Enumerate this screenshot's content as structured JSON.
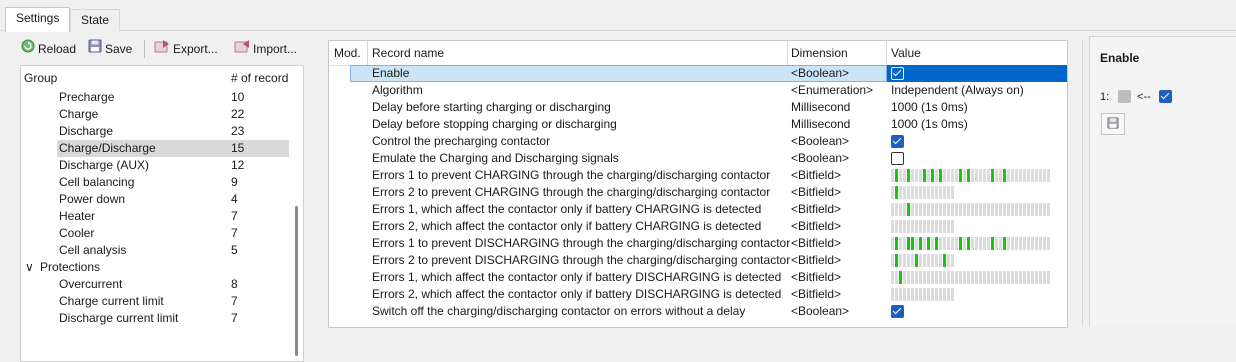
{
  "tabs": [
    {
      "label": "Settings",
      "active": true
    },
    {
      "label": "State",
      "active": false
    }
  ],
  "toolbar": {
    "reload_label": "Reload",
    "save_label": "Save",
    "export_label": "Export...",
    "import_label": "Import..."
  },
  "group_tree": {
    "col_group": "Group",
    "col_count": "# of record",
    "rows": [
      {
        "name": "Precharge",
        "count": "10",
        "level": 2
      },
      {
        "name": "Charge",
        "count": "22",
        "level": 2
      },
      {
        "name": "Discharge",
        "count": "23",
        "level": 2
      },
      {
        "name": "Charge/Discharge",
        "count": "15",
        "level": 2,
        "selected": true
      },
      {
        "name": "Discharge (AUX)",
        "count": "12",
        "level": 2
      },
      {
        "name": "Cell balancing",
        "count": "9",
        "level": 2
      },
      {
        "name": "Power down",
        "count": "4",
        "level": 2
      },
      {
        "name": "Heater",
        "count": "7",
        "level": 2
      },
      {
        "name": "Cooler",
        "count": "7",
        "level": 2
      },
      {
        "name": "Cell analysis",
        "count": "5",
        "level": 2
      },
      {
        "name": "Protections",
        "count": "",
        "level": 1,
        "expanded": true
      },
      {
        "name": "Overcurrent",
        "count": "8",
        "level": 2
      },
      {
        "name": "Charge current limit",
        "count": "7",
        "level": 2
      },
      {
        "name": "Discharge current limit",
        "count": "7",
        "level": 2
      }
    ]
  },
  "grid": {
    "col_mod": "Mod.",
    "col_name": "Record name",
    "col_dim": "Dimension",
    "col_value": "Value",
    "rows": [
      {
        "name": "Enable",
        "dim": "<Boolean>",
        "type": "bool",
        "value": true,
        "selected": true
      },
      {
        "name": "Algorithm",
        "dim": "<Enumeration>",
        "type": "text",
        "value": "Independent (Always on)"
      },
      {
        "name": "Delay before starting charging or discharging",
        "dim": "Millisecond",
        "type": "text",
        "value": "1000 (1s 0ms)"
      },
      {
        "name": "Delay before stopping charging or discharging",
        "dim": "Millisecond",
        "type": "text",
        "value": "1000 (1s 0ms)"
      },
      {
        "name": "Control the precharging contactor",
        "dim": "<Boolean>",
        "type": "bool",
        "value": true
      },
      {
        "name": "Emulate the Charging and Discharging signals",
        "dim": "<Boolean>",
        "type": "bool",
        "value": false
      },
      {
        "name": "Errors 1 to prevent CHARGING through the charging/discharging contactor",
        "dim": "<Bitfield>",
        "type": "bits",
        "bits": "0100100010101000010100000100100000000000"
      },
      {
        "name": "Errors 2 to prevent CHARGING through the charging/discharging contactor",
        "dim": "<Bitfield>",
        "type": "bits",
        "bits": "0100000000000000"
      },
      {
        "name": "Errors 1, which affect the contactor only if battery CHARGING is detected",
        "dim": "<Bitfield>",
        "type": "bits",
        "bits": "0000100000000000000000000000000000000000"
      },
      {
        "name": "Errors 2, which affect the contactor only if battery CHARGING is detected",
        "dim": "<Bitfield>",
        "type": "bits",
        "bits": "0000000000000000"
      },
      {
        "name": "Errors 1 to prevent DISCHARGING through the charging/discharging contactor",
        "dim": "<Bitfield>",
        "type": "bits",
        "bits": "0100110101010000010100000100100000000000"
      },
      {
        "name": "Errors 2 to prevent DISCHARGING through the charging/discharging contactor",
        "dim": "<Bitfield>",
        "type": "bits",
        "bits": "0100001000000100"
      },
      {
        "name": "Errors 1, which affect the contactor only if battery DISCHARGING is detected",
        "dim": "<Bitfield>",
        "type": "bits",
        "bits": "0010000000000000000000000000000000000000"
      },
      {
        "name": "Errors 2, which affect the contactor only if battery DISCHARGING is detected",
        "dim": "<Bitfield>",
        "type": "bits",
        "bits": "0000000000000000"
      },
      {
        "name": "Switch off the charging/discharging contactor on errors without a delay",
        "dim": "<Boolean>",
        "type": "bool",
        "value": true
      }
    ]
  },
  "right_panel": {
    "title": "Enable",
    "row_label": "1:",
    "arrow_text": "<--",
    "device_value": true,
    "edit_value": true
  },
  "colors": {
    "bit_on": "#16c60c",
    "bit_off": "#dcdcdc",
    "selection": "#0066cc",
    "checkbox_on": "#1f5fbf"
  }
}
